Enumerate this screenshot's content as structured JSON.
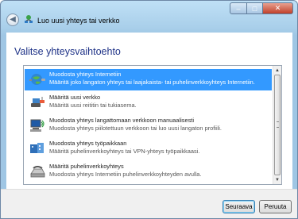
{
  "window": {
    "title": "Luo uusi yhteys tai verkko",
    "minimize_glyph": "–",
    "maximize_glyph": "□",
    "close_glyph": "✕",
    "back_glyph": "◀"
  },
  "main": {
    "heading": "Valitse yhteysvaihtoehto",
    "options": [
      {
        "title": "Muodosta yhteys Internetiin",
        "description": "Määritä joko langaton yhteys tai laajakaista- tai puhelinverkkoyhteys Internetiin.",
        "icon": "globe-icon",
        "selected": true
      },
      {
        "title": "Määritä uusi verkko",
        "description": "Määritä uusi reititin tai tukiasema.",
        "icon": "router-icon",
        "selected": false
      },
      {
        "title": "Muodosta yhteys langattomaan verkkoon manuaalisesti",
        "description": "Muodosta yhteys piilotettuun verkkoon tai luo uusi langaton profiili.",
        "icon": "wireless-computer-icon",
        "selected": false
      },
      {
        "title": "Muodosta yhteys työpaikkaan",
        "description": "Määritä puhelinverkkoyhteys tai VPN-yhteys työpaikkaasi.",
        "icon": "workplace-icon",
        "selected": false
      },
      {
        "title": "Määritä puhelinverkkoyhteys",
        "description": "Muodosta yhteys Internetiin puhelinverkkoyhteyden avulla.",
        "icon": "phone-icon",
        "selected": false
      }
    ]
  },
  "footer": {
    "next_label": "Seuraava",
    "cancel_label": "Peruuta"
  },
  "colors": {
    "selection": "#3399ff",
    "heading": "#1e3287"
  }
}
